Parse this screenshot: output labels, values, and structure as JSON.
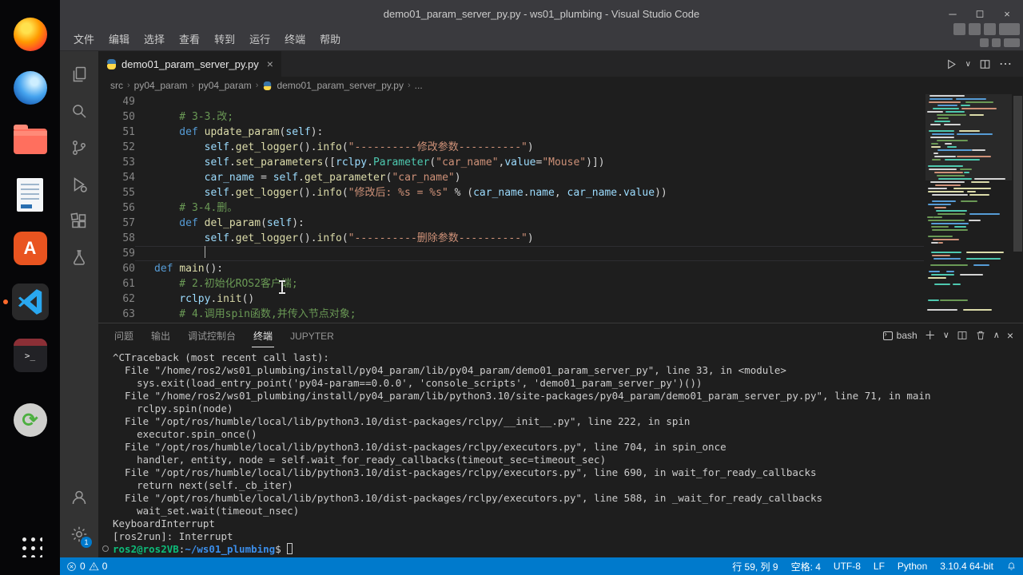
{
  "window": {
    "title": "demo01_param_server_py.py - ws01_plumbing - Visual Studio Code",
    "menu": [
      "文件",
      "编辑",
      "选择",
      "查看",
      "转到",
      "运行",
      "终端",
      "帮助"
    ]
  },
  "dock": {
    "icons": [
      "firefox",
      "browser-blue",
      "files",
      "libreoffice-writer",
      "ubuntu-software",
      "vscode",
      "terminal-app",
      "software-updater",
      "show-applications"
    ],
    "active": "vscode",
    "software_letter": "A",
    "terminal_glyph": ">_",
    "updater_glyph": "⟳"
  },
  "activity_bar": {
    "icons": [
      "explorer",
      "search",
      "source-control",
      "run-debug",
      "extensions",
      "testing"
    ],
    "bottom": [
      "account",
      "settings"
    ],
    "settings_badge": "1"
  },
  "editor": {
    "tab": {
      "label": "demo01_param_server_py.py"
    },
    "breadcrumb": [
      "src",
      "py04_param",
      "py04_param",
      "demo01_param_server_py.py",
      "..."
    ],
    "lines": [
      {
        "num": 49,
        "tokens": []
      },
      {
        "num": 50,
        "tokens": [
          [
            "c",
            "    # 3-3.改;"
          ]
        ]
      },
      {
        "num": 51,
        "tokens": [
          [
            "k",
            "    def "
          ],
          [
            "f",
            "update_param"
          ],
          [
            "p",
            "("
          ],
          [
            "v",
            "self"
          ],
          [
            "p",
            "):"
          ]
        ]
      },
      {
        "num": 52,
        "tokens": [
          [
            "p",
            "        "
          ],
          [
            "v",
            "self"
          ],
          [
            "p",
            "."
          ],
          [
            "f",
            "get_logger"
          ],
          [
            "p",
            "()."
          ],
          [
            "f",
            "info"
          ],
          [
            "p",
            "("
          ],
          [
            "s",
            "\"----------修改参数----------\""
          ],
          [
            "p",
            ")"
          ]
        ]
      },
      {
        "num": 53,
        "tokens": [
          [
            "p",
            "        "
          ],
          [
            "v",
            "self"
          ],
          [
            "p",
            "."
          ],
          [
            "f",
            "set_parameters"
          ],
          [
            "p",
            "(["
          ],
          [
            "v",
            "rclpy"
          ],
          [
            "p",
            "."
          ],
          [
            "t",
            "Parameter"
          ],
          [
            "p",
            "("
          ],
          [
            "s",
            "\"car_name\""
          ],
          [
            "p",
            ","
          ],
          [
            "v",
            "value"
          ],
          [
            "p",
            "="
          ],
          [
            "s",
            "\"Mouse\""
          ],
          [
            "p",
            ")])"
          ]
        ]
      },
      {
        "num": 54,
        "tokens": [
          [
            "p",
            "        "
          ],
          [
            "v",
            "car_name"
          ],
          [
            "p",
            " = "
          ],
          [
            "v",
            "self"
          ],
          [
            "p",
            "."
          ],
          [
            "f",
            "get_parameter"
          ],
          [
            "p",
            "("
          ],
          [
            "s",
            "\"car_name\""
          ],
          [
            "p",
            ")"
          ]
        ]
      },
      {
        "num": 55,
        "tokens": [
          [
            "p",
            "        "
          ],
          [
            "v",
            "self"
          ],
          [
            "p",
            "."
          ],
          [
            "f",
            "get_logger"
          ],
          [
            "p",
            "()."
          ],
          [
            "f",
            "info"
          ],
          [
            "p",
            "("
          ],
          [
            "s",
            "\"修改后: %s = %s\""
          ],
          [
            "p",
            " % ("
          ],
          [
            "v",
            "car_name"
          ],
          [
            "p",
            "."
          ],
          [
            "v",
            "name"
          ],
          [
            "p",
            ", "
          ],
          [
            "v",
            "car_name"
          ],
          [
            "p",
            "."
          ],
          [
            "v",
            "value"
          ],
          [
            "p",
            "))"
          ]
        ]
      },
      {
        "num": 56,
        "tokens": [
          [
            "c",
            "    # 3-4.删。"
          ]
        ]
      },
      {
        "num": 57,
        "tokens": [
          [
            "k",
            "    def "
          ],
          [
            "f",
            "del_param"
          ],
          [
            "p",
            "("
          ],
          [
            "v",
            "self"
          ],
          [
            "p",
            "):"
          ]
        ]
      },
      {
        "num": 58,
        "tokens": [
          [
            "p",
            "        "
          ],
          [
            "v",
            "self"
          ],
          [
            "p",
            "."
          ],
          [
            "f",
            "get_logger"
          ],
          [
            "p",
            "()."
          ],
          [
            "f",
            "info"
          ],
          [
            "p",
            "("
          ],
          [
            "s",
            "\"----------删除参数----------\""
          ],
          [
            "p",
            ")"
          ]
        ]
      },
      {
        "num": 59,
        "tokens": [],
        "current": true,
        "caret_col": 9
      },
      {
        "num": 60,
        "tokens": [
          [
            "k",
            "def "
          ],
          [
            "f",
            "main"
          ],
          [
            "p",
            "():"
          ]
        ]
      },
      {
        "num": 61,
        "tokens": [
          [
            "c",
            "    # 2.初始化ROS2客户端;"
          ]
        ]
      },
      {
        "num": 62,
        "tokens": [
          [
            "p",
            "    "
          ],
          [
            "v",
            "rclpy"
          ],
          [
            "p",
            "."
          ],
          [
            "f",
            "init"
          ],
          [
            "p",
            "()"
          ]
        ]
      },
      {
        "num": 63,
        "tokens": [
          [
            "c",
            "    # 4.调用spin函数,并传入节点对象;"
          ]
        ]
      }
    ]
  },
  "panel": {
    "tabs": [
      {
        "label": "问题"
      },
      {
        "label": "输出"
      },
      {
        "label": "调试控制台"
      },
      {
        "label": "终端",
        "active": true
      },
      {
        "label": "JUPYTER"
      }
    ],
    "shell_label": "bash",
    "terminal": {
      "lines": [
        "^CTraceback (most recent call last):",
        "  File \"/home/ros2/ws01_plumbing/install/py04_param/lib/py04_param/demo01_param_server_py\", line 33, in <module>",
        "    sys.exit(load_entry_point('py04-param==0.0.0', 'console_scripts', 'demo01_param_server_py')())",
        "  File \"/home/ros2/ws01_plumbing/install/py04_param/lib/python3.10/site-packages/py04_param/demo01_param_server_py.py\", line 71, in main",
        "    rclpy.spin(node)",
        "  File \"/opt/ros/humble/local/lib/python3.10/dist-packages/rclpy/__init__.py\", line 222, in spin",
        "    executor.spin_once()",
        "  File \"/opt/ros/humble/local/lib/python3.10/dist-packages/rclpy/executors.py\", line 704, in spin_once",
        "    handler, entity, node = self.wait_for_ready_callbacks(timeout_sec=timeout_sec)",
        "  File \"/opt/ros/humble/local/lib/python3.10/dist-packages/rclpy/executors.py\", line 690, in wait_for_ready_callbacks",
        "    return next(self._cb_iter)",
        "  File \"/opt/ros/humble/local/lib/python3.10/dist-packages/rclpy/executors.py\", line 588, in _wait_for_ready_callbacks",
        "    wait_set.wait(timeout_nsec)",
        "KeyboardInterrupt",
        "[ros2run]: Interrupt"
      ],
      "prompt": [
        [
          "g",
          "ros2@ros2VB"
        ],
        [
          "p",
          ":"
        ],
        [
          "b",
          "~/ws01_plumbing"
        ],
        [
          "p",
          "$ "
        ]
      ]
    }
  },
  "status_bar": {
    "errors": "0",
    "warnings": "0",
    "items": [
      "行 59, 列 9",
      "空格: 4",
      "UTF-8",
      "LF",
      "Python",
      "3.10.4 64-bit"
    ]
  },
  "colors": {
    "accent": "#007acc",
    "comment": "#6a9955",
    "keyword": "#569cd6",
    "function": "#dcdcaa",
    "variable": "#9cdcfe",
    "string": "#ce9178",
    "class": "#4ec9b0",
    "prompt_user": "#0dbc79",
    "prompt_path": "#3b8eea"
  }
}
